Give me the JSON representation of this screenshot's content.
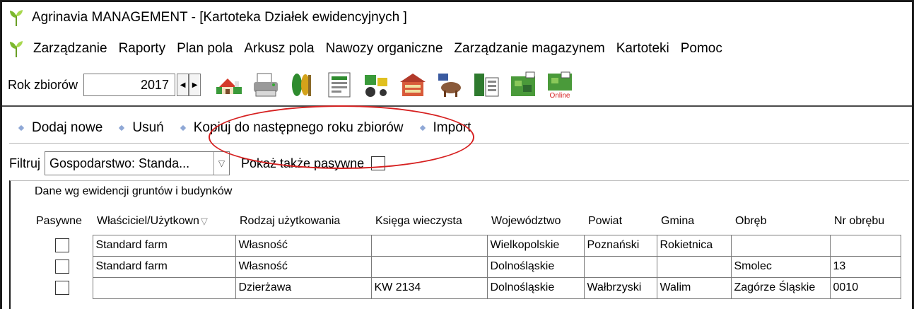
{
  "window": {
    "title": "Agrinavia MANAGEMENT - [Kartoteka Działek ewidencyjnych ]",
    "brand_color": "#7cb82f"
  },
  "menu": {
    "items": [
      "Zarządzanie",
      "Raporty",
      "Plan pola",
      "Arkusz pola",
      "Nawozy organiczne",
      "Zarządzanie magazynem",
      "Kartoteki",
      "Pomoc"
    ]
  },
  "toolbar": {
    "year_label": "Rok zbiorów",
    "year_value": "2017",
    "tools": [
      "farm-icon",
      "printer-icon",
      "crops-icon",
      "field-sheet-icon",
      "machinery-icon",
      "store-icon",
      "animals-icon",
      "storage-icon",
      "map-icon",
      "map-online-icon"
    ],
    "online_badge": "Online"
  },
  "actions": {
    "add_new": "Dodaj nowe",
    "delete": "Usuń",
    "copy_next_year": "Kopiuj do następnego roku zbiorów",
    "import": "Import",
    "highlight_color": "#d62020"
  },
  "filter": {
    "label": "Filtruj",
    "value": "Gospodarstwo: Standa...",
    "show_passive_label": "Pokaż także pasywne",
    "show_passive_checked": false
  },
  "grid": {
    "group_caption": "Dane wg ewidencji gruntów i budynków",
    "columns": [
      "Pasywne",
      "Właściciel/Użytkown",
      "Rodzaj użytkowania",
      "Księga wieczysta",
      "Województwo",
      "Powiat",
      "Gmina",
      "Obręb",
      "Nr obrębu"
    ],
    "rows": [
      {
        "pasywne": false,
        "owner": "Standard farm",
        "usage": "Własność",
        "land_register": "",
        "voivodeship": "Wielkopolskie",
        "county": "Poznański",
        "commune": "Rokietnica",
        "precinct": "",
        "precinct_no": ""
      },
      {
        "pasywne": false,
        "owner": "Standard farm",
        "usage": "Własność",
        "land_register": "",
        "voivodeship": "Dolnośląskie",
        "county": "",
        "commune": "",
        "precinct": "Smolec",
        "precinct_no": "13"
      },
      {
        "pasywne": false,
        "owner": "",
        "usage": "Dzierżawa",
        "land_register": "KW 2134",
        "voivodeship": "Dolnośląskie",
        "county": "Wałbrzyski",
        "commune": "Walim",
        "precinct": "Zagórze Śląskie",
        "precinct_no": "0010"
      }
    ]
  }
}
